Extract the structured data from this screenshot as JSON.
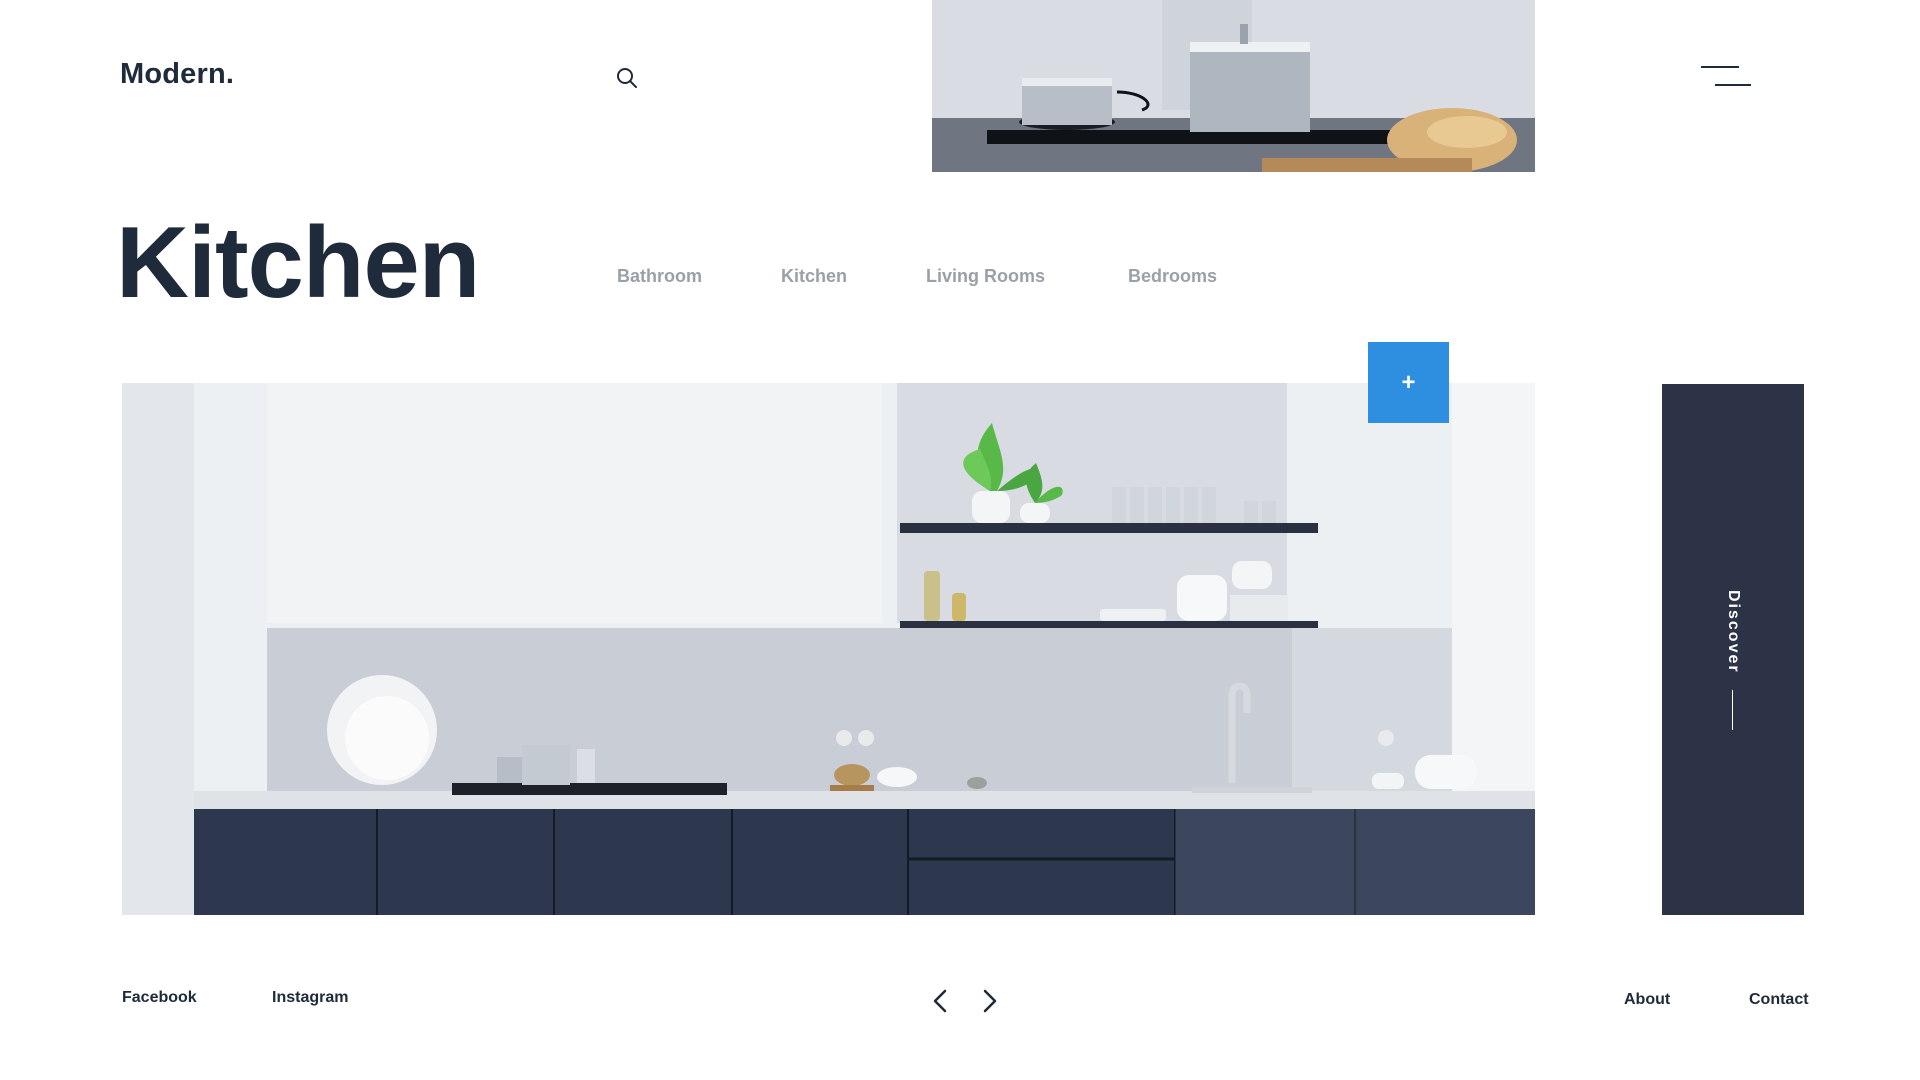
{
  "header": {
    "logo": "Modern.",
    "search_icon": "search-icon",
    "menu_icon": "hamburger-menu-icon"
  },
  "hero": {
    "title": "Kitchen"
  },
  "categories": [
    {
      "label": "Bathroom"
    },
    {
      "label": "Kitchen"
    },
    {
      "label": "Living Rooms"
    },
    {
      "label": "Bedrooms"
    }
  ],
  "add_button": {
    "label": "+",
    "color": "#2e8ee0"
  },
  "discover": {
    "label": "Discover",
    "color": "#2d3346"
  },
  "footer": {
    "social": [
      "Facebook",
      "Instagram"
    ],
    "links": [
      "About",
      "Contact"
    ],
    "prev_icon": "chevron-left-icon",
    "next_icon": "chevron-right-icon"
  },
  "colors": {
    "text_dark": "#1f2a3a",
    "text_muted": "#9aa0a8",
    "accent_blue": "#2e8ee0",
    "panel_navy": "#2d3346",
    "cabinet_navy": "#263142"
  }
}
